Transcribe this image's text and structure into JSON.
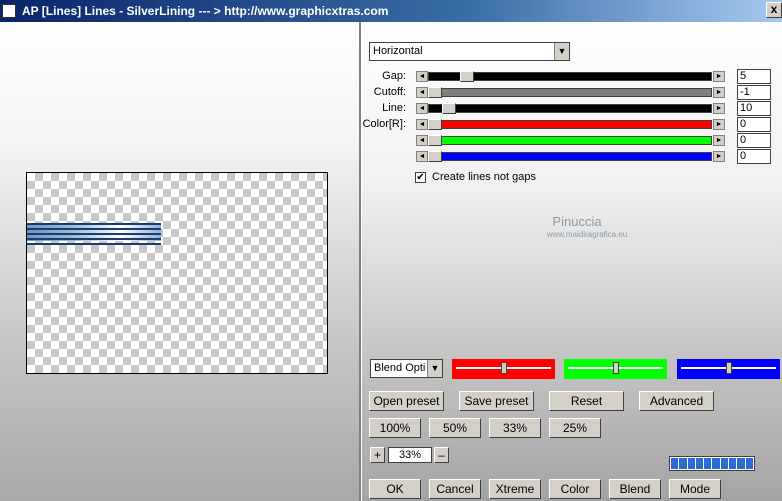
{
  "window": {
    "title": "AP [Lines]  Lines - SilverLining     --- > http://www.graphicxtras.com",
    "close_glyph": "x"
  },
  "direction": {
    "value": "Horizontal",
    "arrow": "▼"
  },
  "sliders": [
    {
      "label": "Gap:",
      "value": "5",
      "color": "#000000",
      "level_pct": 12
    },
    {
      "label": "Cutoff:",
      "value": "-1",
      "color": "#808080",
      "level_pct": 0
    },
    {
      "label": "Line:",
      "value": "10",
      "color": "#000000",
      "level_pct": 5
    },
    {
      "label": "Color[R]:",
      "value": "0",
      "color": "#ff0000",
      "level_pct": 0
    },
    {
      "label": "",
      "value": "0",
      "color": "#00ff00",
      "level_pct": 0
    },
    {
      "label": "",
      "value": "0",
      "color": "#0000ff",
      "level_pct": 0
    }
  ],
  "arrows": {
    "left": "◄",
    "right": "►"
  },
  "create_lines": {
    "label": "Create lines not gaps",
    "checked": true,
    "mark": "✔"
  },
  "watermark": {
    "name": "Pinuccia",
    "url": "www.maidiragrafica.eu"
  },
  "blend": {
    "value": "Blend Optio",
    "arrow": "▼"
  },
  "color_boxes": [
    {
      "color": "#ff0000",
      "level_pct": 50
    },
    {
      "color": "#00ff00",
      "level_pct": 50
    },
    {
      "color": "#0000ff",
      "level_pct": 50
    }
  ],
  "buttons": {
    "open_preset": "Open preset",
    "save_preset": "Save preset",
    "reset": "Reset",
    "advanced": "Advanced"
  },
  "zoom_buttons": [
    "100%",
    "50%",
    "33%",
    "25%"
  ],
  "zoom": {
    "plus": "+",
    "value": "33%",
    "minus": "–"
  },
  "progress_pct": 100,
  "bottom_buttons": {
    "ok": "OK",
    "cancel": "Cancel",
    "xtreme": "Xtreme",
    "color": "Color",
    "blend": "Blend",
    "mode": "Mode"
  }
}
